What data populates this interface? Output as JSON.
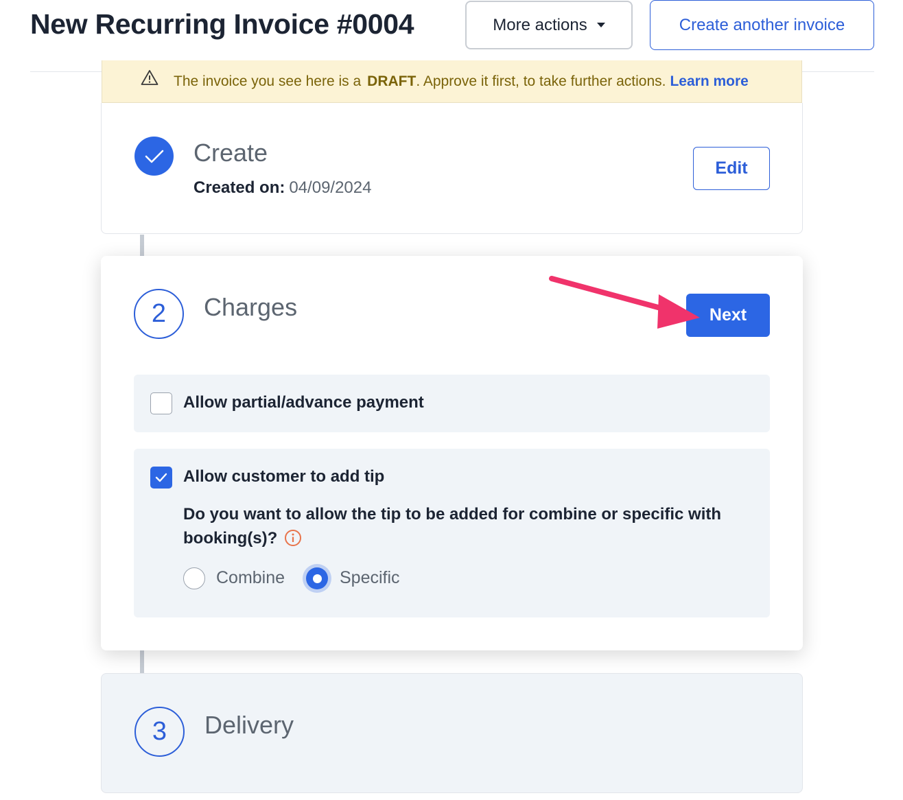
{
  "header": {
    "title": "New Recurring Invoice #0004",
    "more_actions_label": "More actions",
    "create_another_label": "Create another invoice"
  },
  "banner": {
    "text_before": "The invoice you see here is a",
    "draft_word": "DRAFT",
    "text_after": ". Approve it first, to take further actions.",
    "learn_more": "Learn more"
  },
  "steps": {
    "create": {
      "title": "Create",
      "created_on_label": "Created on:",
      "created_on_value": "04/09/2024",
      "edit_label": "Edit",
      "status": "completed"
    },
    "charges": {
      "number": "2",
      "title": "Charges",
      "next_label": "Next",
      "options": {
        "partial": {
          "label": "Allow partial/advance payment",
          "checked": false
        },
        "tip": {
          "label": "Allow customer to add tip",
          "checked": true,
          "question": "Do you want to allow the tip to be added for combine or specific with booking(s)?",
          "choices": [
            {
              "label": "Combine",
              "selected": false
            },
            {
              "label": "Specific",
              "selected": true
            }
          ]
        }
      }
    },
    "delivery": {
      "number": "3",
      "title": "Delivery"
    }
  },
  "icons": {
    "warning": "warning-triangle-icon",
    "check": "check-icon",
    "info": "info-icon",
    "caret": "chevron-down-icon"
  },
  "colors": {
    "primary": "#2c66e4",
    "banner_bg": "#fcf3d5",
    "banner_text": "#7a6309",
    "annotation_arrow": "#f0336b",
    "info": "#e8734a"
  }
}
